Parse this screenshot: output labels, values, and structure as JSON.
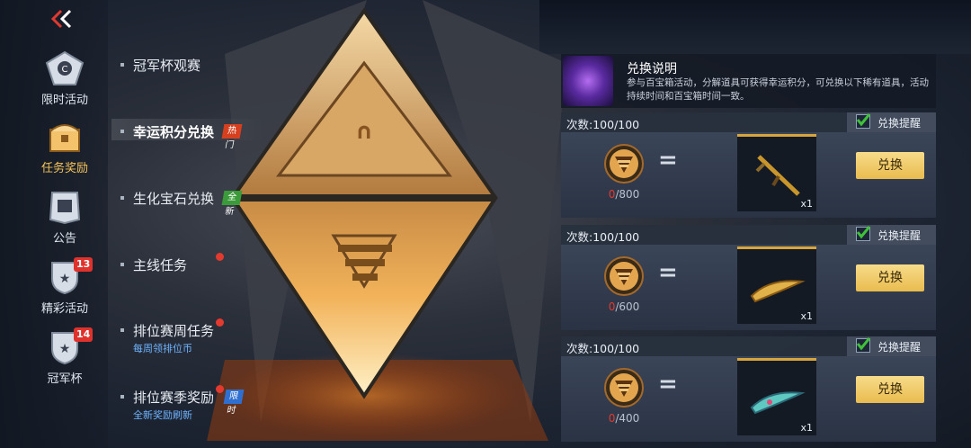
{
  "rail": {
    "items": [
      {
        "label": "限时活动",
        "icon": "c-emblem-icon",
        "badge": ""
      },
      {
        "label": "任务奖励",
        "icon": "treasure-chest-icon",
        "badge": ""
      },
      {
        "label": "公告",
        "icon": "notice-board-icon",
        "badge": ""
      },
      {
        "label": "精彩活动",
        "icon": "shield-star-icon",
        "badge": "13"
      },
      {
        "label": "冠军杯",
        "icon": "shield-star-icon",
        "badge": "14"
      }
    ]
  },
  "menu": {
    "items": [
      {
        "label": "冠军杯观赛",
        "sub": "",
        "tag": ""
      },
      {
        "label": "幸运积分兑换",
        "sub": "",
        "tag": "热门"
      },
      {
        "label": "生化宝石兑换",
        "sub": "",
        "tag": "全新"
      },
      {
        "label": "主线任务",
        "sub": "",
        "tag": ""
      },
      {
        "label": "排位赛周任务",
        "sub": "每周领排位币",
        "tag": ""
      },
      {
        "label": "排位赛季奖励",
        "sub": "全新奖励刷新",
        "tag": "限时"
      }
    ]
  },
  "info": {
    "title": "兑换说明",
    "desc": "参与百宝箱活动，分解道具可获得幸运积分，可兑换以下稀有道具，活动持续时间和百宝箱时间一致。"
  },
  "cards": [
    {
      "count": "次数:100/100",
      "remind": "兑换提醒",
      "current": "0",
      "total": "/800",
      "qty": "x1",
      "button": "兑换",
      "item_icon": "rifle-icon"
    },
    {
      "count": "次数:100/100",
      "remind": "兑换提醒",
      "current": "0",
      "total": "/600",
      "qty": "x1",
      "button": "兑换",
      "item_icon": "gold-knife-icon"
    },
    {
      "count": "次数:100/100",
      "remind": "兑换提醒",
      "current": "0",
      "total": "/400",
      "qty": "x1",
      "button": "兑换",
      "item_icon": "jade-knife-icon"
    }
  ],
  "colors": {
    "accent": "#f5c35a",
    "button": "#f0c865",
    "hot": "#d6401f",
    "new": "#3b9a3a",
    "limited": "#2f6fd0",
    "check": "#3fc23a"
  }
}
